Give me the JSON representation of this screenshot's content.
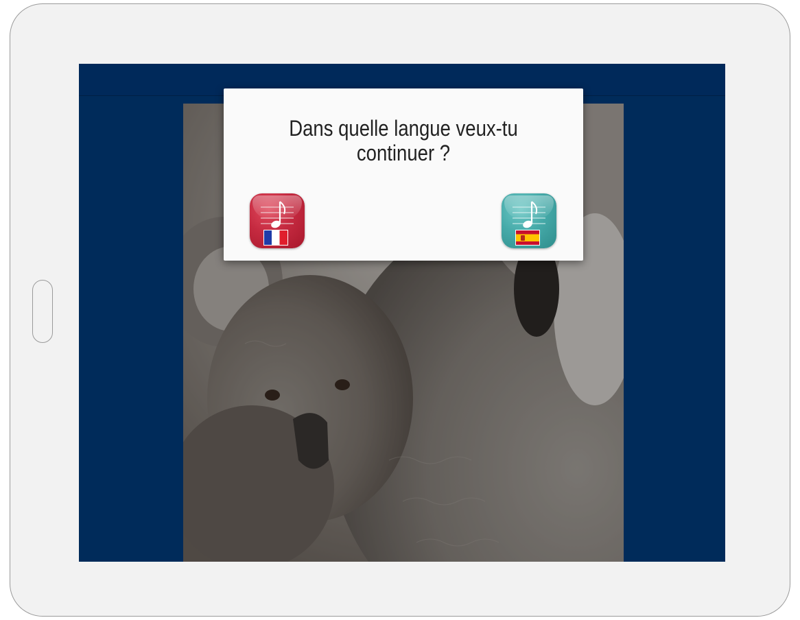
{
  "dialog": {
    "title_line1": "Dans quelle langue veux-tu",
    "title_line2": "continuer ?"
  },
  "languages": [
    {
      "code": "fr",
      "icon": "music-note-icon",
      "flag": "flag-france-icon",
      "color": "#c52a40"
    },
    {
      "code": "es",
      "icon": "music-note-icon",
      "flag": "flag-spain-icon",
      "color": "#46aaa9"
    }
  ],
  "colors": {
    "app_background": "#002b5a",
    "dialog_background": "#fafafa"
  }
}
